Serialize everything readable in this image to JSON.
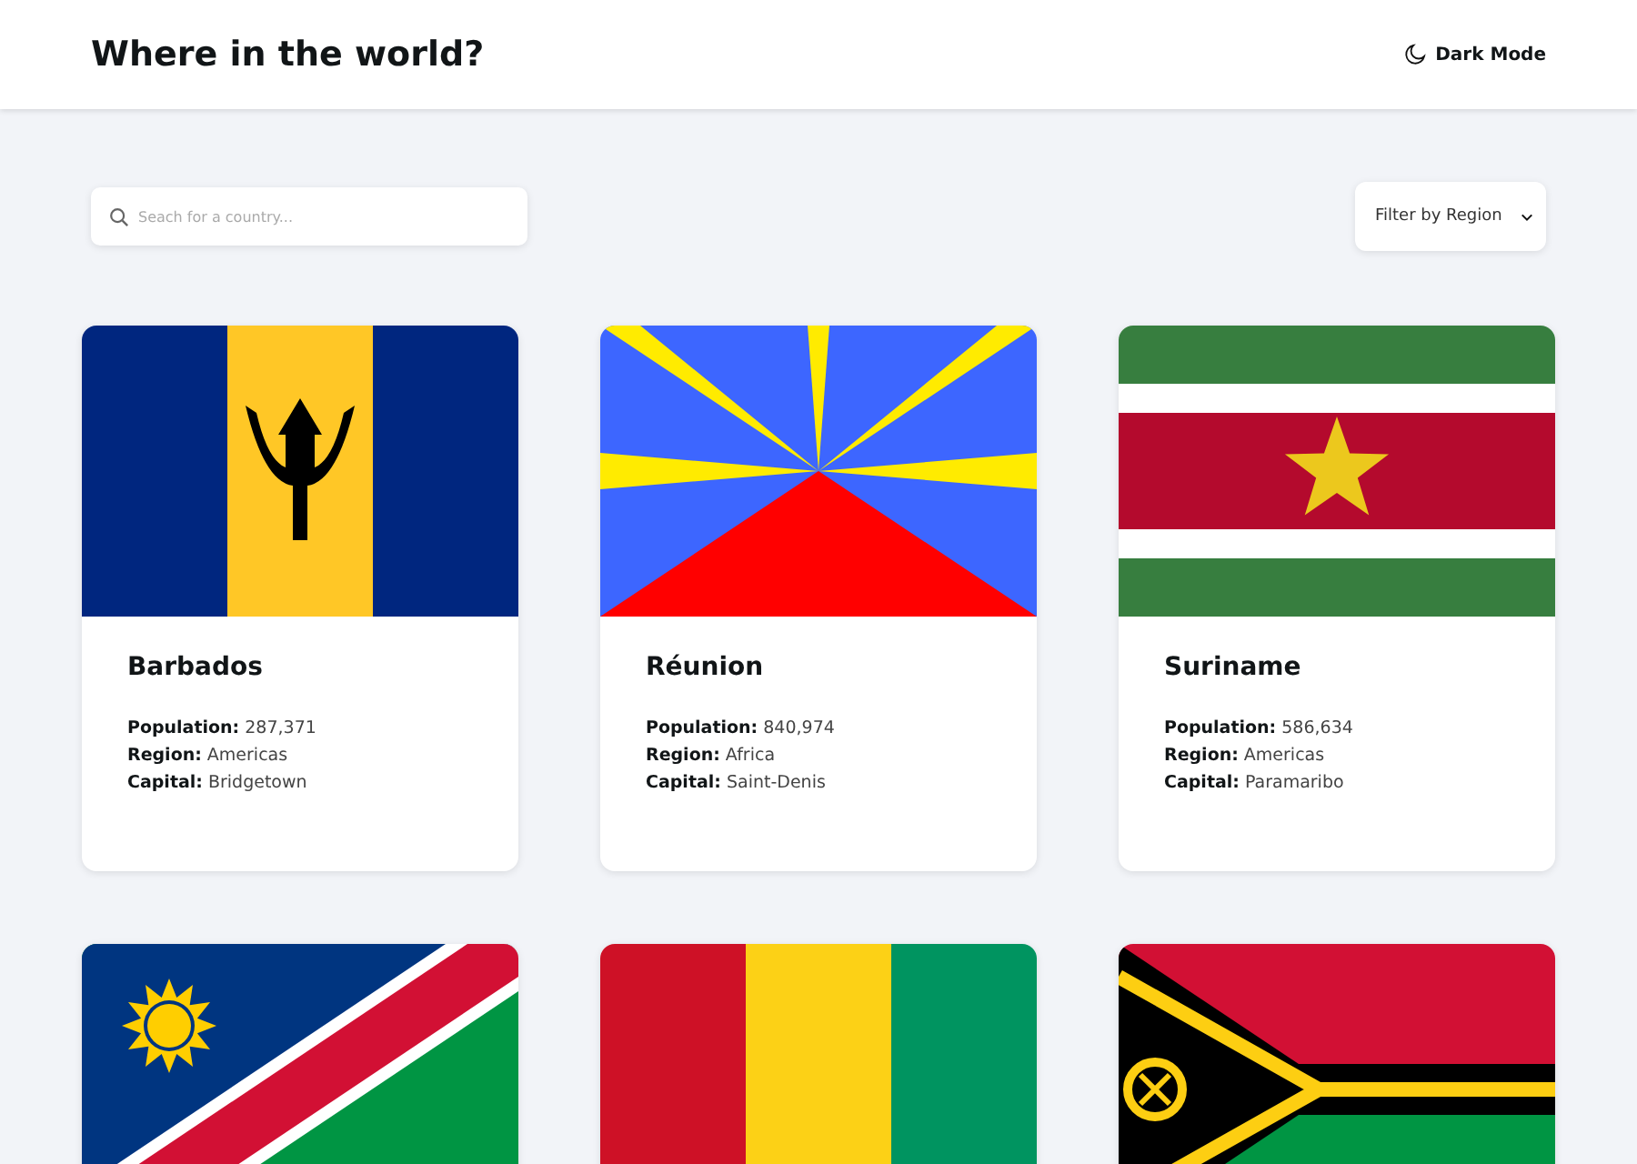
{
  "header": {
    "title": "Where in the world?",
    "theme_toggle": "Dark Mode"
  },
  "search": {
    "placeholder": "Seach for a country..."
  },
  "filter": {
    "label": "Filter by Region"
  },
  "countries": [
    {
      "kind": "barbados",
      "name": "Barbados",
      "details": [
        "**Population:** 287,371",
        "**Region:** Americas",
        "**Capital:** Bridgetown"
      ]
    },
    {
      "kind": "reunion",
      "name": "Réunion",
      "details": [
        "**Population:** 840,974",
        "**Region:** Africa",
        "**Capital:** Saint-Denis"
      ]
    },
    {
      "kind": "suriname",
      "name": "Suriname",
      "details": [
        "**Population:** 586,634",
        "**Region:** Americas",
        "**Capital:** Paramaribo"
      ]
    },
    {
      "kind": "namibia"
    },
    {
      "kind": "guinea"
    },
    {
      "kind": "vanuatu"
    }
  ]
}
